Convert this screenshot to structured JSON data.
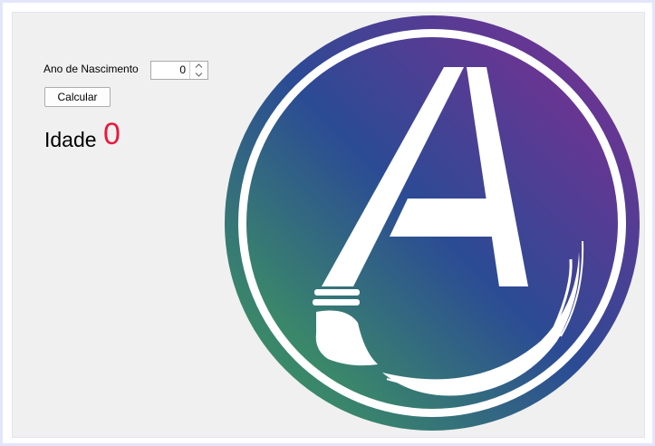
{
  "form": {
    "birth_year_label": "Ano de Nascimento",
    "birth_year_value": "0",
    "calculate_label": "Calcular"
  },
  "result": {
    "age_label": "Idade",
    "age_value": "0"
  },
  "colors": {
    "age_value": "#e8193f",
    "logo_gradient": [
      "#3f9b5c",
      "#2b4b95",
      "#7a2f92"
    ]
  },
  "icons": {
    "logo": "brush-letter-a-logo",
    "spinner_up": "chevron-up-icon",
    "spinner_down": "chevron-down-icon"
  }
}
